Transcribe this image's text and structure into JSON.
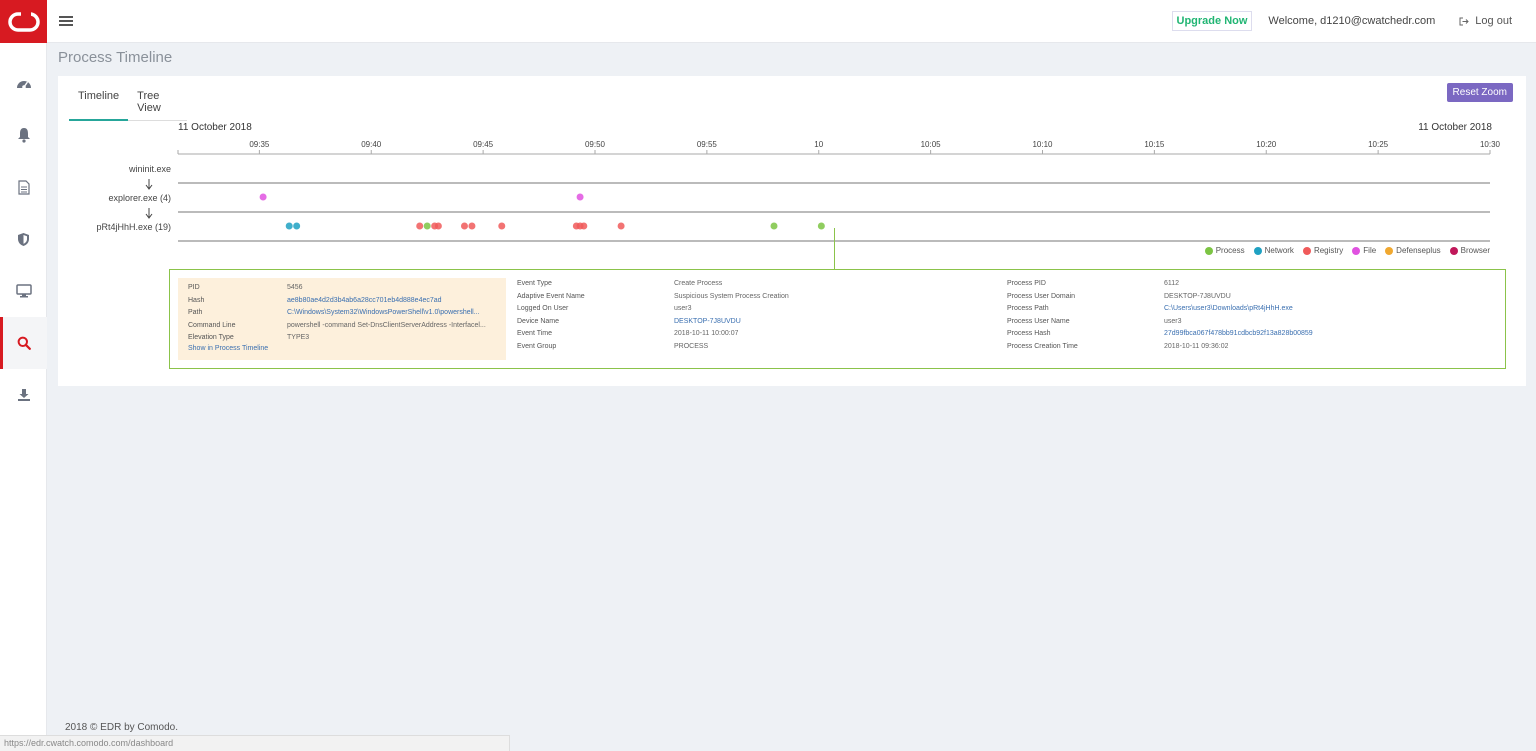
{
  "app": {
    "brand_color": "#d71a21"
  },
  "sidebar": {
    "items": [
      {
        "icon": "dashboard-icon"
      },
      {
        "icon": "bell-icon"
      },
      {
        "icon": "document-icon"
      },
      {
        "icon": "shield-icon"
      },
      {
        "icon": "monitor-icon"
      },
      {
        "icon": "search-icon",
        "active": true
      },
      {
        "icon": "download-icon"
      }
    ]
  },
  "topbar": {
    "upgrade_label": "Upgrade Now",
    "welcome_text": "Welcome, d1210@cwatchedr.com",
    "logout_label": "Log out"
  },
  "page": {
    "title": "Process Timeline"
  },
  "tabs": [
    {
      "label": "Timeline",
      "active": true
    },
    {
      "label": "Tree View",
      "active": false
    }
  ],
  "reset_zoom_label": "Reset Zoom",
  "timeline": {
    "start_date": "11 October 2018",
    "end_date": "11 October 2018",
    "ticks": [
      "09:35",
      "09:40",
      "09:45",
      "09:50",
      "09:55",
      "10",
      "10:05",
      "10:10",
      "10:15",
      "10:20",
      "10:25",
      "10:30"
    ],
    "rows": [
      {
        "label": "wininit.exe"
      },
      {
        "label": "explorer.exe (4)"
      },
      {
        "label": "pRt4jHhH.exe (19)"
      }
    ],
    "events": [
      {
        "row": 1,
        "time": "09:35:10",
        "type": "File"
      },
      {
        "row": 1,
        "time": "09:49:20",
        "type": "File"
      },
      {
        "row": 2,
        "time": "09:36:20",
        "type": "Network"
      },
      {
        "row": 2,
        "time": "09:36:40",
        "type": "Network"
      },
      {
        "row": 2,
        "time": "09:42:10",
        "type": "Registry"
      },
      {
        "row": 2,
        "time": "09:42:30",
        "type": "Process"
      },
      {
        "row": 2,
        "time": "09:42:50",
        "type": "Registry"
      },
      {
        "row": 2,
        "time": "09:43:00",
        "type": "Registry"
      },
      {
        "row": 2,
        "time": "09:44:10",
        "type": "Registry"
      },
      {
        "row": 2,
        "time": "09:44:30",
        "type": "Registry"
      },
      {
        "row": 2,
        "time": "09:45:50",
        "type": "Registry"
      },
      {
        "row": 2,
        "time": "09:49:10",
        "type": "Registry"
      },
      {
        "row": 2,
        "time": "09:49:20",
        "type": "Registry"
      },
      {
        "row": 2,
        "time": "09:49:30",
        "type": "Registry"
      },
      {
        "row": 2,
        "time": "09:51:10",
        "type": "Registry"
      },
      {
        "row": 2,
        "time": "09:58:00",
        "type": "Process"
      },
      {
        "row": 2,
        "time": "10:00:07",
        "type": "Process"
      }
    ],
    "legend": [
      {
        "label": "Process",
        "color": "#7cc443"
      },
      {
        "label": "Network",
        "color": "#1fa1c2"
      },
      {
        "label": "Registry",
        "color": "#f05a5a"
      },
      {
        "label": "File",
        "color": "#e052e0"
      },
      {
        "label": "Defenseplus",
        "color": "#f0a830"
      },
      {
        "label": "Browser",
        "color": "#c0185a"
      }
    ]
  },
  "detail": {
    "left": [
      {
        "key": "PID",
        "value": "5456",
        "link": false
      },
      {
        "key": "Hash",
        "value": "ae8b80ae4d2d3b4ab6a28cc701eb4d888e4ec7ad",
        "link": true
      },
      {
        "key": "Path",
        "value": "C:\\Windows\\System32\\WindowsPowerShell\\v1.0\\powershell...",
        "link": true
      },
      {
        "key": "Command Line",
        "value": "powershell -command Set-DnsClientServerAddress -Interfacel...",
        "link": false
      },
      {
        "key": "Elevation Type",
        "value": "TYPE3",
        "link": false
      }
    ],
    "show_link": "Show in Process Timeline",
    "middle": [
      {
        "key": "Event Type",
        "value": "Create Process",
        "link": false
      },
      {
        "key": "Adaptive Event Name",
        "value": "Suspicious System Process Creation",
        "link": false
      },
      {
        "key": "Logged On User",
        "value": "user3",
        "link": false
      },
      {
        "key": "Device Name",
        "value": "DESKTOP-7J8UVDU",
        "link": true
      },
      {
        "key": "Event Time",
        "value": "2018-10-11 10:00:07",
        "link": false
      },
      {
        "key": "Event Group",
        "value": "PROCESS",
        "link": false
      }
    ],
    "right": [
      {
        "key": "Process PID",
        "value": "6112",
        "link": false
      },
      {
        "key": "Process User Domain",
        "value": "DESKTOP-7J8UVDU",
        "link": false
      },
      {
        "key": "Process Path",
        "value": "C:\\Users\\user3\\Downloads\\pRt4jHhH.exe",
        "link": true
      },
      {
        "key": "Process User Name",
        "value": "user3",
        "link": false
      },
      {
        "key": "Process Hash",
        "value": "27d99fbca067f478bb91cdbcb92f13a828b00859",
        "link": true
      },
      {
        "key": "Process Creation Time",
        "value": "2018-10-11 09:36:02",
        "link": false
      }
    ]
  },
  "footer": {
    "text": "2018 © EDR by Comodo."
  },
  "status_url": "https://edr.cwatch.comodo.com/dashboard"
}
